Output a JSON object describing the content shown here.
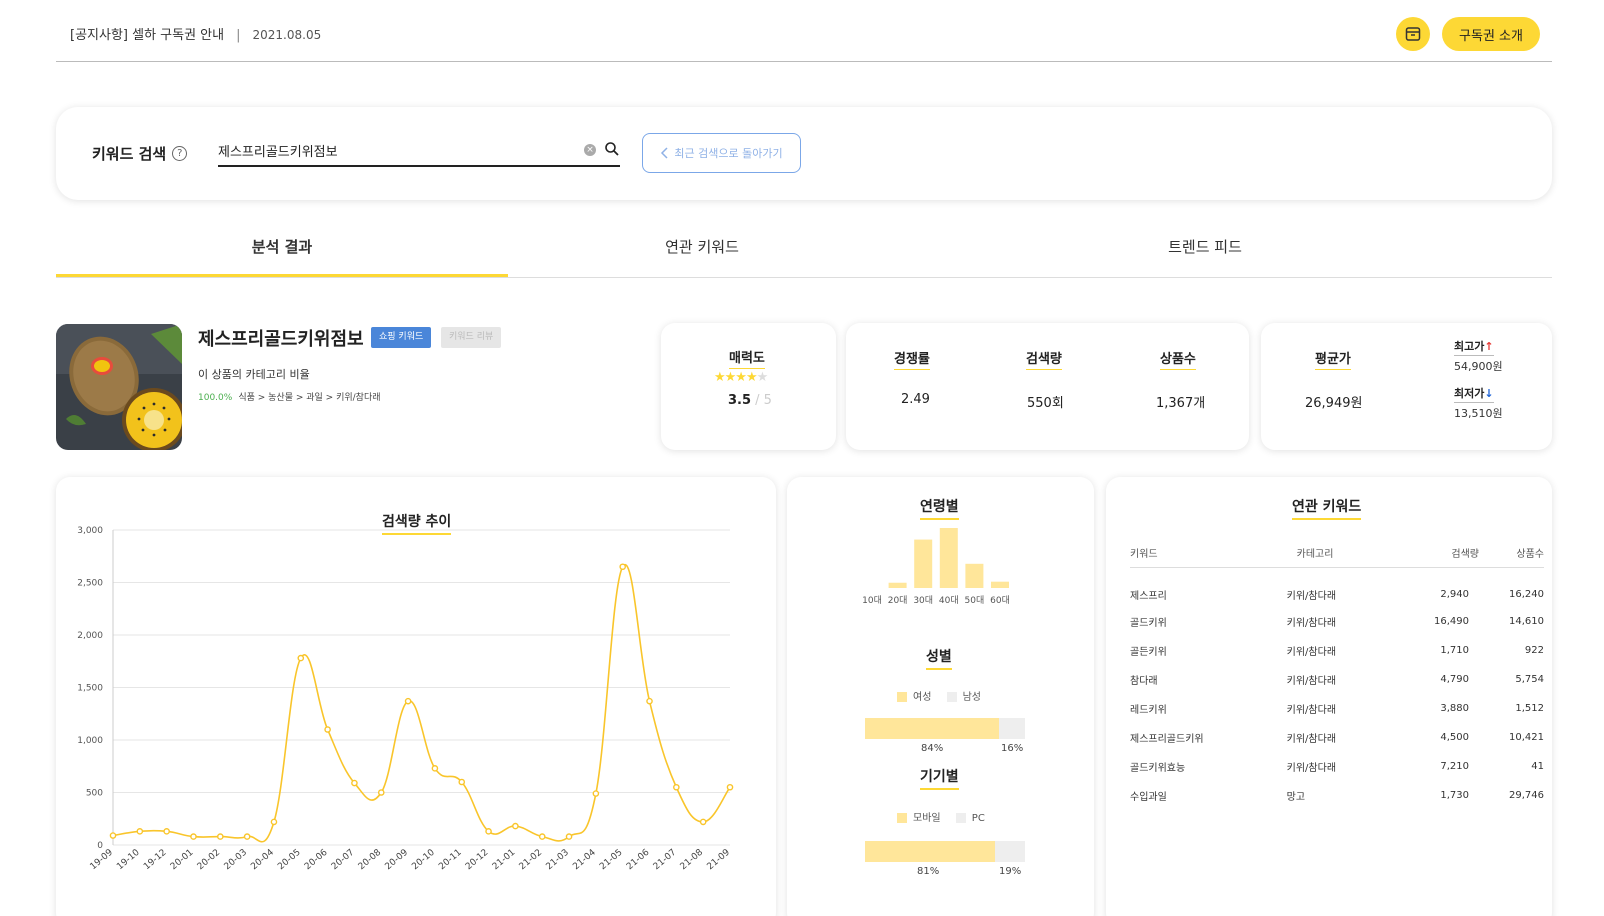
{
  "notice": {
    "title": "[공지사항] 셀하 구독권 안내",
    "separator": "|",
    "date": "2021.08.05"
  },
  "header": {
    "subscription_button": "구독권 소개",
    "box_icon": "archive-box-icon"
  },
  "search": {
    "label": "키워드 검색",
    "help": "?",
    "value": "제스프리골드키위점보",
    "clear": "×",
    "back_button": "최근 검색으로 돌아가기"
  },
  "tabs": [
    {
      "label": "분석 결과",
      "active": true
    },
    {
      "label": "연관 키워드",
      "active": false
    },
    {
      "label": "트렌드 피드",
      "active": false
    }
  ],
  "product": {
    "name": "제스프리골드키위점보",
    "badge_primary": "쇼핑 키워드",
    "badge_secondary": "키워드 리뷰",
    "category_ratio_title": "이 상품의 카테고리 비율",
    "category_pct": "100.0%",
    "category_path": "식품 > 농산물 > 과일 > 키위/참다래"
  },
  "stats": {
    "attractiveness": {
      "label": "매력도",
      "value": "3.5",
      "max": " / 5",
      "stars": 3.5
    },
    "competition": {
      "label": "경쟁률",
      "value": "2.49"
    },
    "search_volume": {
      "label": "검색량",
      "value": "550회"
    },
    "product_count": {
      "label": "상품수",
      "value": "1,367개"
    },
    "avg_price": {
      "label": "평균가",
      "value": "26,949원"
    },
    "max_price": {
      "label": "최고가",
      "value": "54,900원"
    },
    "min_price": {
      "label": "최저가",
      "value": "13,510원"
    }
  },
  "colors": {
    "accent": "#FDD835",
    "chart_line": "#F9C52B",
    "bar": "#FFE69A",
    "blue": "#4A86D9",
    "up": "#E53935",
    "down": "#1E63D6"
  },
  "trend_panel": {
    "title": "검색량 추이"
  },
  "chart_data": [
    {
      "type": "line",
      "title": "검색량 추이",
      "x": [
        "19-09",
        "19-10",
        "19-12",
        "20-01",
        "20-02",
        "20-03",
        "20-04",
        "20-05",
        "20-06",
        "20-07",
        "20-08",
        "20-09",
        "20-10",
        "20-11",
        "20-12",
        "21-01",
        "21-02",
        "21-03",
        "21-04",
        "21-05",
        "21-06",
        "21-07",
        "21-08",
        "21-09"
      ],
      "y": [
        90,
        130,
        130,
        80,
        80,
        80,
        220,
        1780,
        1100,
        590,
        500,
        1370,
        730,
        600,
        130,
        180,
        80,
        80,
        490,
        2650,
        1370,
        550,
        220,
        550
      ],
      "y_ticks": [
        0,
        500,
        1000,
        1500,
        2000,
        2500,
        3000
      ],
      "y_tick_labels": [
        "0",
        "500",
        "1,000",
        "1,500",
        "2,000",
        "2,500",
        "3,000"
      ],
      "ylim": [
        0,
        3000
      ],
      "grid": true
    },
    {
      "type": "bar",
      "title": "연령별",
      "categories": [
        "10대",
        "20대",
        "30대",
        "40대",
        "50대",
        "60대"
      ],
      "values": [
        0,
        5,
        46,
        57,
        23,
        6
      ]
    }
  ],
  "age_panel": {
    "title": "연령별"
  },
  "gender": {
    "title": "성별",
    "legend": [
      "여성",
      "남성"
    ],
    "female_pct": "84%",
    "male_pct": "16%",
    "female_fraction": 0.84
  },
  "device": {
    "title": "기기별",
    "legend": [
      "모바일",
      "PC"
    ],
    "mobile_pct": "81%",
    "pc_pct": "19%",
    "mobile_fraction": 0.81
  },
  "related": {
    "title": "연관 키워드",
    "columns": [
      "키워드",
      "카테고리",
      "검색량",
      "상품수"
    ],
    "rows": [
      [
        "제스프리",
        "키위/참다래",
        "2,940",
        "16,240"
      ],
      [
        "골드키위",
        "키위/참다래",
        "16,490",
        "14,610"
      ],
      [
        "골든키위",
        "키위/참다래",
        "1,710",
        "922"
      ],
      [
        "참다래",
        "키위/참다래",
        "4,790",
        "5,754"
      ],
      [
        "레드키위",
        "키위/참다래",
        "3,880",
        "1,512"
      ],
      [
        "제스프리골드키위",
        "키위/참다래",
        "4,500",
        "10,421"
      ],
      [
        "골드키위효능",
        "키위/참다래",
        "7,210",
        "41"
      ],
      [
        "수입과일",
        "망고",
        "1,730",
        "29,746"
      ]
    ]
  }
}
